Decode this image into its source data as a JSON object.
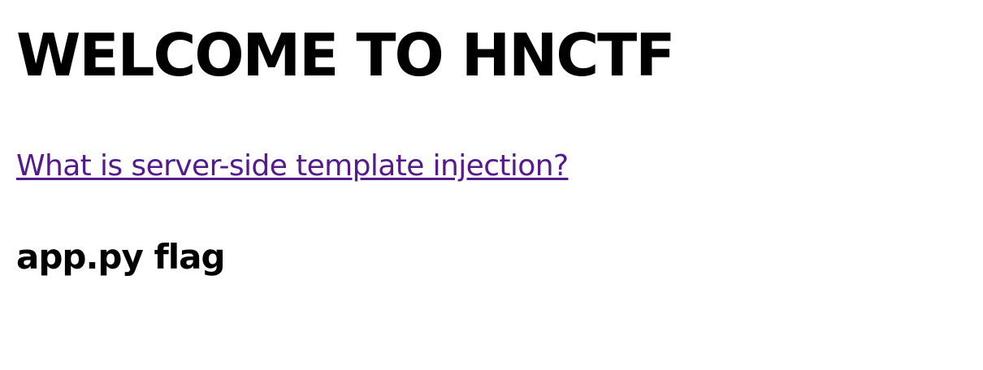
{
  "page": {
    "title": "WELCOME TO HNCTF",
    "link_text": "What is server-side template injection?",
    "subheading": "app.py flag"
  },
  "colors": {
    "text": "#000000",
    "visited_link": "#551a8b",
    "background": "#ffffff"
  }
}
